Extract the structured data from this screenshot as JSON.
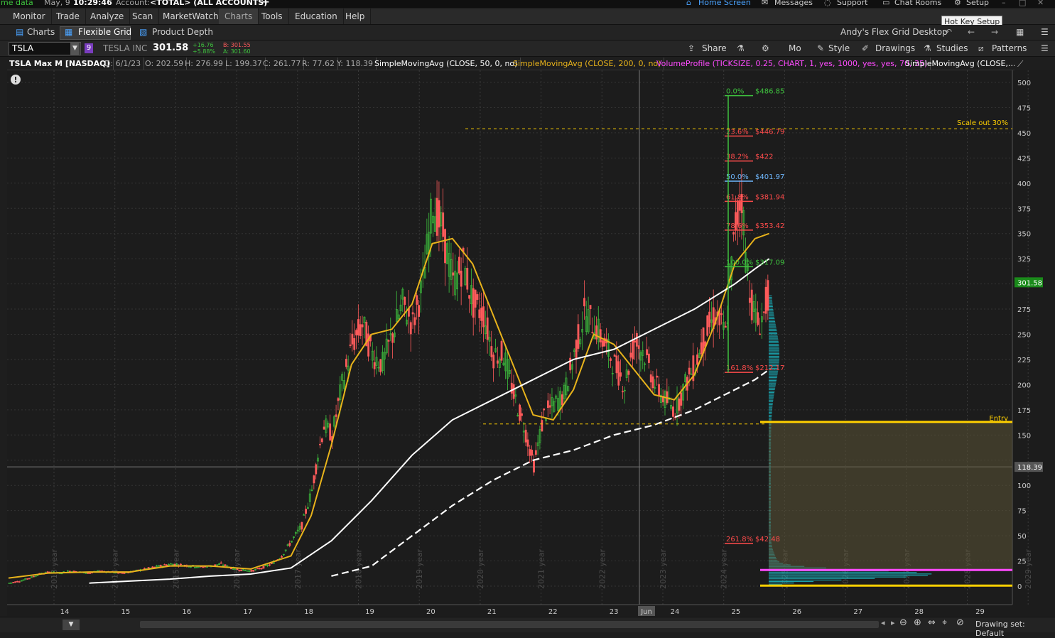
{
  "statusbar": {
    "left_text": "me data",
    "date": "May, 9",
    "time": "10:29:46",
    "account_label": "Account:",
    "account_value": "<TOTAL> (ALL ACCOUNTS)",
    "add_label": "+",
    "home_screen": "Home Screen",
    "messages": "Messages",
    "support": "Support",
    "chat_rooms": "Chat Rooms",
    "setup": "Setup"
  },
  "tooltip": "Hot Key Setup",
  "menu": [
    "Monitor",
    "Trade",
    "Analyze",
    "Scan",
    "MarketWatch",
    "Charts",
    "Tools",
    "Education",
    "Help"
  ],
  "subbar": {
    "charts": "Charts",
    "flexible_grid": "Flexible Grid",
    "product_depth": "Product Depth",
    "desktop": "Andy's Flex Grid Desktop"
  },
  "symbar": {
    "symbol": "TSLA",
    "company": "TESLA INC",
    "last": "301.58",
    "change": "+16.76",
    "change_pct": "+5.88%",
    "bid": "B: 301.55",
    "ask": "A: 301.60",
    "share": "Share",
    "period": "Mo",
    "style": "Style",
    "drawings": "Drawings",
    "studies": "Studies",
    "patterns": "Patterns"
  },
  "studybar": {
    "title": "TSLA Max M [NASDAQ]",
    "date": "D: 6/1/23",
    "open": "O: 202.59",
    "high": "H: 276.99",
    "low": "L: 199.37",
    "close": "C: 261.77",
    "range": "R: 77.62",
    "y": "Y: 118.39",
    "sma50": "SimpleMovingAvg (CLOSE, 50, 0, no)",
    "sma200": "SimpleMovingAvg (CLOSE, 200, 0, no)",
    "volprofile": "VolumeProfile (TICKSIZE, 0.25, CHART, 1, yes, 1000, yes, yes, 70, 35)",
    "sma_more": "SimpleMovingAvg (CLOSE,..."
  },
  "colors": {
    "up": "#3ec23e",
    "down": "#ff5b5b",
    "sma_short": "#e8b31b",
    "sma50": "#ffffff",
    "sma200": "#ffffff",
    "fib_green": "#3ec23e",
    "fib_red": "#ff4b4b",
    "fib_blue": "#6fb8ff",
    "entry": "#ffd000",
    "volume_profile": "#1ab8c4",
    "magenta": "#ff4bff",
    "price_tag": "#1a8a1a"
  },
  "chart_data": {
    "type": "candlestick",
    "title": "TSLA Max M [NASDAQ]",
    "y_ticks": [
      0,
      25,
      50,
      75,
      100,
      125,
      150,
      175,
      200,
      225,
      250,
      275,
      300,
      325,
      350,
      375,
      400,
      425,
      450,
      475,
      500
    ],
    "x_ticks": [
      "14",
      "15",
      "16",
      "17",
      "18",
      "19",
      "20",
      "21",
      "22",
      "23",
      "Jun",
      "24",
      "25",
      "26",
      "27",
      "28",
      "29"
    ],
    "year_labels": [
      "2013 year",
      "2014 year",
      "2015 year",
      "2016 year",
      "2017 year",
      "2018 year",
      "2019 year",
      "2020 year",
      "2021 year",
      "2022 year",
      "2023 year",
      "2024 year",
      "2025 year",
      "2026 year",
      "2027 year",
      "2028 year",
      "2029 year"
    ],
    "current_price": "301.58",
    "crosshair_price": "118.39",
    "fib_levels": [
      {
        "pct": "0.0%",
        "price": "$486.85",
        "value": 486.85,
        "color": "green"
      },
      {
        "pct": "23.6%",
        "price": "$446.79",
        "value": 446.79,
        "color": "red"
      },
      {
        "pct": "38.2%",
        "price": "$422",
        "value": 422,
        "color": "red"
      },
      {
        "pct": "50.0%",
        "price": "$401.97",
        "value": 401.97,
        "color": "blue"
      },
      {
        "pct": "61.8%",
        "price": "$381.94",
        "value": 381.94,
        "color": "red"
      },
      {
        "pct": "78.6%",
        "price": "$353.42",
        "value": 353.42,
        "color": "red"
      },
      {
        "pct": "100.0%",
        "price": "$317.09",
        "value": 317.09,
        "color": "green"
      },
      {
        "pct": "161.8%",
        "price": "$212.17",
        "value": 212.17,
        "color": "red"
      },
      {
        "pct": "261.8%",
        "price": "$42.48",
        "value": 42.48,
        "color": "red"
      }
    ],
    "annotations": [
      {
        "text": "Scale out 30%",
        "value": 454
      },
      {
        "text": "Entry",
        "value": 163
      }
    ],
    "price_path": [
      [
        0,
        3
      ],
      [
        5,
        5
      ],
      [
        10,
        8
      ],
      [
        15,
        12
      ],
      [
        20,
        14
      ],
      [
        25,
        13
      ],
      [
        30,
        15
      ],
      [
        35,
        14
      ],
      [
        40,
        13
      ],
      [
        45,
        15
      ],
      [
        50,
        14
      ],
      [
        55,
        13
      ],
      [
        60,
        14
      ],
      [
        65,
        16
      ],
      [
        70,
        18
      ],
      [
        75,
        20
      ],
      [
        80,
        22
      ],
      [
        85,
        21
      ],
      [
        90,
        20
      ],
      [
        95,
        19
      ],
      [
        100,
        20
      ],
      [
        105,
        22
      ],
      [
        110,
        18
      ],
      [
        115,
        16
      ],
      [
        120,
        15
      ],
      [
        125,
        18
      ],
      [
        130,
        22
      ],
      [
        135,
        30
      ],
      [
        140,
        45
      ],
      [
        145,
        60
      ],
      [
        150,
        95
      ],
      [
        153,
        130
      ],
      [
        156,
        160
      ],
      [
        160,
        150
      ],
      [
        165,
        200
      ],
      [
        170,
        240
      ],
      [
        175,
        260
      ],
      [
        180,
        230
      ],
      [
        185,
        220
      ],
      [
        190,
        250
      ],
      [
        195,
        280
      ],
      [
        200,
        260
      ],
      [
        205,
        300
      ],
      [
        210,
        380
      ],
      [
        215,
        350
      ],
      [
        220,
        300
      ],
      [
        225,
        320
      ],
      [
        230,
        280
      ],
      [
        235,
        270
      ],
      [
        240,
        230
      ],
      [
        245,
        230
      ],
      [
        250,
        190
      ],
      [
        255,
        160
      ],
      [
        260,
        120
      ],
      [
        265,
        170
      ],
      [
        270,
        180
      ],
      [
        275,
        190
      ],
      [
        280,
        230
      ],
      [
        285,
        270
      ],
      [
        290,
        260
      ],
      [
        295,
        240
      ],
      [
        300,
        220
      ],
      [
        305,
        200
      ],
      [
        310,
        245
      ],
      [
        315,
        230
      ],
      [
        320,
        200
      ],
      [
        325,
        185
      ],
      [
        330,
        175
      ],
      [
        335,
        200
      ],
      [
        340,
        220
      ],
      [
        345,
        250
      ],
      [
        350,
        270
      ],
      [
        355,
        250
      ],
      [
        360,
        360
      ],
      [
        363,
        390
      ],
      [
        365,
        330
      ],
      [
        368,
        280
      ],
      [
        371,
        260
      ],
      [
        374,
        270
      ],
      [
        377,
        300
      ]
    ],
    "sma_short_path": [
      [
        0,
        8
      ],
      [
        20,
        13
      ],
      [
        40,
        14
      ],
      [
        60,
        14
      ],
      [
        80,
        20
      ],
      [
        100,
        20
      ],
      [
        120,
        17
      ],
      [
        140,
        30
      ],
      [
        150,
        70
      ],
      [
        160,
        140
      ],
      [
        170,
        220
      ],
      [
        180,
        250
      ],
      [
        190,
        255
      ],
      [
        200,
        280
      ],
      [
        210,
        340
      ],
      [
        220,
        345
      ],
      [
        230,
        320
      ],
      [
        240,
        270
      ],
      [
        250,
        220
      ],
      [
        260,
        170
      ],
      [
        270,
        165
      ],
      [
        280,
        195
      ],
      [
        290,
        250
      ],
      [
        300,
        240
      ],
      [
        310,
        215
      ],
      [
        320,
        190
      ],
      [
        330,
        185
      ],
      [
        340,
        210
      ],
      [
        350,
        260
      ],
      [
        360,
        320
      ],
      [
        370,
        345
      ],
      [
        377,
        350
      ]
    ],
    "sma50_path": [
      [
        40,
        3
      ],
      [
        60,
        5
      ],
      [
        80,
        7
      ],
      [
        100,
        10
      ],
      [
        120,
        12
      ],
      [
        140,
        18
      ],
      [
        160,
        45
      ],
      [
        180,
        85
      ],
      [
        200,
        130
      ],
      [
        220,
        165
      ],
      [
        240,
        185
      ],
      [
        260,
        205
      ],
      [
        280,
        225
      ],
      [
        300,
        235
      ],
      [
        320,
        255
      ],
      [
        340,
        275
      ],
      [
        360,
        300
      ],
      [
        370,
        315
      ],
      [
        377,
        325
      ]
    ],
    "sma200_path": [
      [
        160,
        10
      ],
      [
        180,
        20
      ],
      [
        200,
        50
      ],
      [
        220,
        80
      ],
      [
        240,
        105
      ],
      [
        260,
        125
      ],
      [
        280,
        135
      ],
      [
        300,
        150
      ],
      [
        320,
        160
      ],
      [
        340,
        175
      ],
      [
        360,
        195
      ],
      [
        370,
        205
      ],
      [
        377,
        215
      ]
    ]
  }
}
